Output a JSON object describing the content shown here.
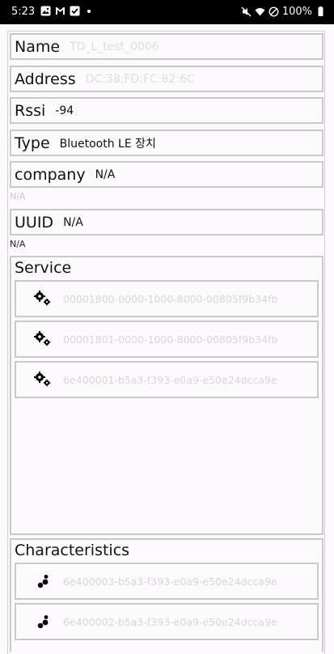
{
  "status_bar": {
    "time": "5:23",
    "battery": "100%",
    "left_icons": [
      "image-icon",
      "gmail-icon",
      "checkbox-icon"
    ],
    "right_icons": [
      "mute-icon",
      "wifi-icon",
      "dnd-icon",
      "battery-icon"
    ]
  },
  "fields": {
    "name": {
      "label": "Name",
      "value": "TD_L_test_0006"
    },
    "address": {
      "label": "Address",
      "value": "DC:38:FD:FC:82:6C"
    },
    "rssi": {
      "label": "Rssi",
      "value": "-94"
    },
    "type": {
      "label": "Type",
      "value": "Bluetooth LE 장치"
    },
    "company": {
      "label": "company",
      "value": "N/A",
      "below": "N/A"
    },
    "uuid": {
      "label": "UUID",
      "value": "N/A",
      "below": "N/A"
    }
  },
  "services": {
    "title": "Service",
    "items": [
      "00001800-0000-1000-8000-00805f9b34fb",
      "00001801-0000-1000-8000-00805f9b34fb",
      "6e400001-b5a3-f393-e0a9-e50e24dcca9e"
    ]
  },
  "characteristics": {
    "title": "Characteristics",
    "items": [
      "6e400003-b5a3-f393-e0a9-e50e24dcca9e",
      "6e400002-b5a3-f393-e0a9-e50e24dcca9e"
    ]
  }
}
